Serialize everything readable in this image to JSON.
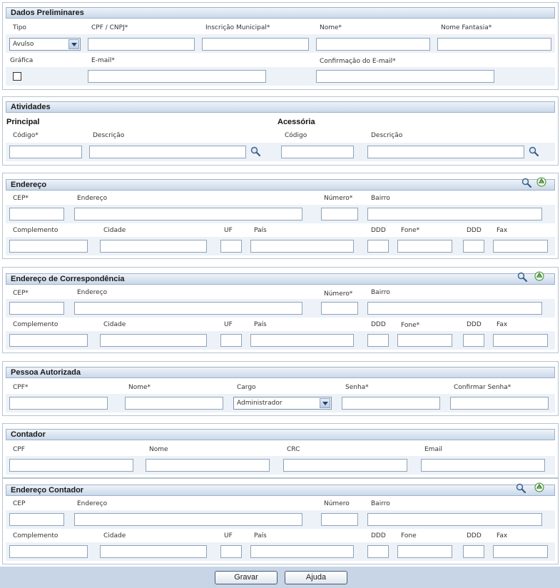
{
  "dados": {
    "title": "Dados Preliminares",
    "tipo_label": "Tipo",
    "tipo_value": "Avulso",
    "cpf_cnpj_label": "CPF / CNPJ*",
    "inscricao_label": "Inscrição Municipal*",
    "nome_label": "Nome*",
    "nome_fantasia_label": "Nome Fantasia*",
    "grafica_label": "Gráfica",
    "email_label": "E-mail*",
    "confirmacao_email_label": "Confirmação do E-mail*"
  },
  "atividades": {
    "title": "Atividades",
    "principal": "Principal",
    "acessoria": "Acessória",
    "codigo_req": "Código*",
    "codigo": "Código",
    "descricao": "Descrição"
  },
  "endereco": {
    "title": "Endereço",
    "cep": "CEP*",
    "endereco": "Endereço",
    "numero": "Número*",
    "bairro": "Bairro",
    "complemento": "Complemento",
    "cidade": "Cidade",
    "uf": "UF",
    "pais": "País",
    "ddd": "DDD",
    "fone": "Fone*",
    "ddd2": "DDD",
    "fax": "Fax"
  },
  "correspondencia": {
    "title": "Endereço de Correspondência",
    "cep": "CEP*",
    "endereco": "Endereço",
    "numero": "Número*",
    "bairro": "Bairro",
    "complemento": "Complemento",
    "cidade": "Cidade",
    "uf": "UF",
    "pais": "País",
    "ddd": "DDD",
    "fone": "Fone*",
    "ddd2": "DDD",
    "fax": "Fax"
  },
  "pessoa": {
    "title": "Pessoa Autorizada",
    "cpf": "CPF*",
    "nome": "Nome*",
    "cargo": "Cargo",
    "cargo_value": "Administrador",
    "senha": "Senha*",
    "confirmar_senha": "Confirmar Senha*"
  },
  "contador": {
    "title": "Contador",
    "cpf": "CPF",
    "nome": "Nome",
    "crc": "CRC",
    "email": "Email"
  },
  "endereco_contador": {
    "title": "Endereço Contador",
    "cep": "CEP",
    "endereco": "Endereço",
    "numero": "Número",
    "bairro": "Bairro",
    "complemento": "Complemento",
    "cidade": "Cidade",
    "uf": "UF",
    "pais": "País",
    "ddd": "DDD",
    "fone": "Fone",
    "ddd2": "DDD",
    "fax": "Fax"
  },
  "buttons": {
    "gravar": "Gravar",
    "ajuda": "Ajuda"
  },
  "icons": {
    "search": "magnifier-icon",
    "recycle": "recycle-icon"
  }
}
